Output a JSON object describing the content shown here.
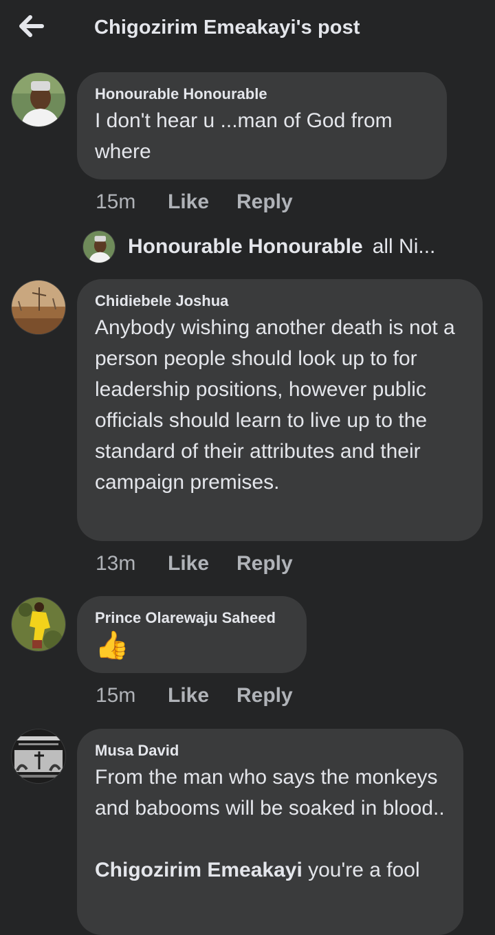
{
  "header": {
    "title": "Chigozirim Emeakayi's post",
    "back_icon": "arrow-left-icon"
  },
  "comments": [
    {
      "author": "Honourable Honourable",
      "text": "I don't hear u ...man of God from where",
      "time": "15m",
      "like_label": "Like",
      "reply_label": "Reply",
      "avatar": "avatar-man-with-cap",
      "reply_preview": {
        "author": "Honourable Honourable",
        "snippet": "all Ni..."
      }
    },
    {
      "author": "Chidiebele Joshua",
      "text": "Anybody wishing another death is not a person people should look up to for leadership positions, however public officials should learn to live up to the standard of their attributes and their campaign premises.",
      "time": "13m",
      "like_label": "Like",
      "reply_label": "Reply",
      "avatar": "avatar-landscape"
    },
    {
      "author": "Prince Olarewaju Saheed",
      "text": "👍",
      "time": "15m",
      "like_label": "Like",
      "reply_label": "Reply",
      "avatar": "avatar-person-in-yellow"
    },
    {
      "author": "Musa David",
      "text": "From the man who says the monkeys and babooms will be soaked in blood..",
      "mention": "Chigozirim Emeakayi",
      "mention_suffix": "you're a fool",
      "avatar": "avatar-poster-image"
    }
  ],
  "colors": {
    "background": "#242526",
    "bubble": "#3a3b3c",
    "text": "#e4e6eb",
    "secondary_text": "#b0b3b8"
  }
}
